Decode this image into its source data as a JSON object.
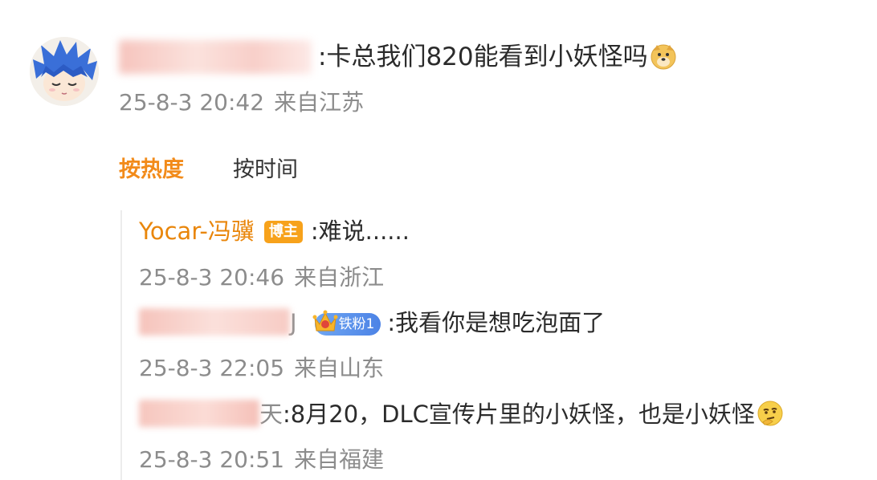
{
  "main_comment": {
    "text": ":卡总我们820能看到小妖怪吗",
    "emoji": "doge-emoji",
    "time": "25-8-3 20:42",
    "location": "来自江苏"
  },
  "sort": {
    "hot_label": "按热度",
    "time_label": "按时间",
    "active": "hot",
    "active_color": "#f28b1a"
  },
  "replies": [
    {
      "name": "Yocar-冯骥",
      "badge": "博主",
      "text": ":难说......",
      "time": "25-8-3 20:46",
      "location": "来自浙江"
    },
    {
      "name_tail": "J",
      "fan_badge": "铁粉1",
      "text": ":我看你是想吃泡面了",
      "time": "25-8-3 22:05",
      "location": "来自山东"
    },
    {
      "name_tail": "天",
      "text": ":8月20，DLC宣传片里的小妖怪，也是小妖怪",
      "emoji": "thinking-emoji",
      "time": "25-8-3 20:51",
      "location": "来自福建"
    }
  ],
  "colors": {
    "accent": "#f28b1a",
    "meta_text": "#8c8c8c",
    "boss_badge": "#f7a21b",
    "fan_badge": "#4c83e6"
  }
}
